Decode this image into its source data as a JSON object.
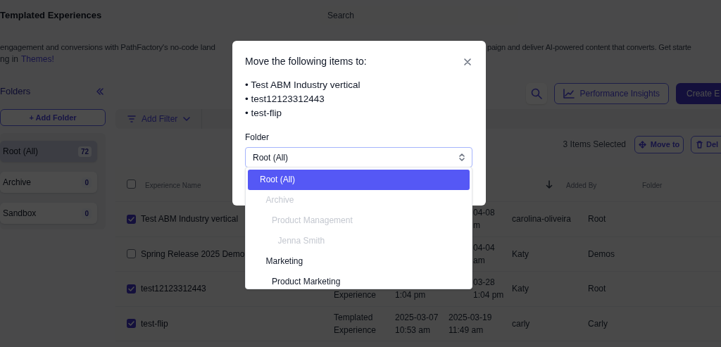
{
  "header": {
    "title": "Templated Experiences",
    "search": {
      "placeholder": "Search"
    }
  },
  "description": {
    "left": "engagement and conversions with PathFactory's no-code land",
    "right": "paign and deliver AI-powered content that converts. Get starte",
    "line2": {
      "text": "ng in",
      "link": "Themes!"
    }
  },
  "sidebar": {
    "title": "Folders",
    "add_button": "+ Add Folder",
    "folders": [
      {
        "name": "Root (All)",
        "count": "72",
        "selected": true
      },
      {
        "name": "Archive",
        "count": "0",
        "selected": false
      },
      {
        "name": "Sandbox",
        "count": "0",
        "selected": false
      }
    ]
  },
  "toolbar": {
    "performance_button": "Performance Insights",
    "create_button": "Create E"
  },
  "filter_bar": {
    "add_filter": "Add Filter"
  },
  "selection": {
    "count_text": "3 Items Selected",
    "move_button": "Move to",
    "delete_button": "Del"
  },
  "table": {
    "header": {
      "select_all_checked": false,
      "name": "Experience Name",
      "sort_descending": true,
      "added_by": "Added By",
      "folder": "Folder"
    },
    "rows": [
      {
        "checked": true,
        "name": "Test ABM Industry vertical",
        "column_5": {
          "top": "04-08",
          "bottom": "m",
          "clipped": true
        },
        "added_by": "carolina-oliveira",
        "folder": "Root"
      },
      {
        "checked": false,
        "name": "Spring Release 2025 Demo",
        "column_5": {
          "top": "04-04",
          "bottom": "am",
          "clipped": true
        },
        "added_by": "Katy",
        "folder": "Demos"
      },
      {
        "checked": true,
        "name": "test12123312443",
        "column_3": {
          "bottom": "Experience"
        },
        "column_4": {
          "bottom": "1:04 pm"
        },
        "column_5": {
          "top": "03-28",
          "bottom": "1:04 pm",
          "clipped": true
        },
        "added_by": "Katy",
        "folder": "Root"
      },
      {
        "checked": true,
        "name": "test-flip",
        "column_3": {
          "top": "Templated",
          "bottom": "Experience"
        },
        "column_4": {
          "top": "2025-03-07",
          "bottom": "10:53 am"
        },
        "column_5": {
          "top": "2025-03-19",
          "bottom": "11:49 am"
        },
        "added_by": "carly",
        "folder": "Carly"
      }
    ]
  },
  "modal": {
    "title": "Move the following items to:",
    "items": [
      "• Test ABM Industry vertical",
      "• test12123312443",
      "• test-flip"
    ],
    "field_label": "Folder",
    "select": {
      "value": "Root (All)"
    },
    "options": [
      {
        "label": "Root (All)",
        "selected": true,
        "disabled": false,
        "children": [
          {
            "label": "Archive",
            "selected": false,
            "disabled": true,
            "children": [
              {
                "label": "Product Management",
                "selected": false,
                "disabled": true,
                "children": [
                  {
                    "label": "Jenna Smith",
                    "selected": false,
                    "disabled": true
                  }
                ]
              }
            ]
          },
          {
            "label": "Marketing",
            "selected": false,
            "disabled": false,
            "children": [
              {
                "label": "Product Marketing",
                "selected": false,
                "disabled": false
              }
            ]
          }
        ]
      }
    ]
  }
}
